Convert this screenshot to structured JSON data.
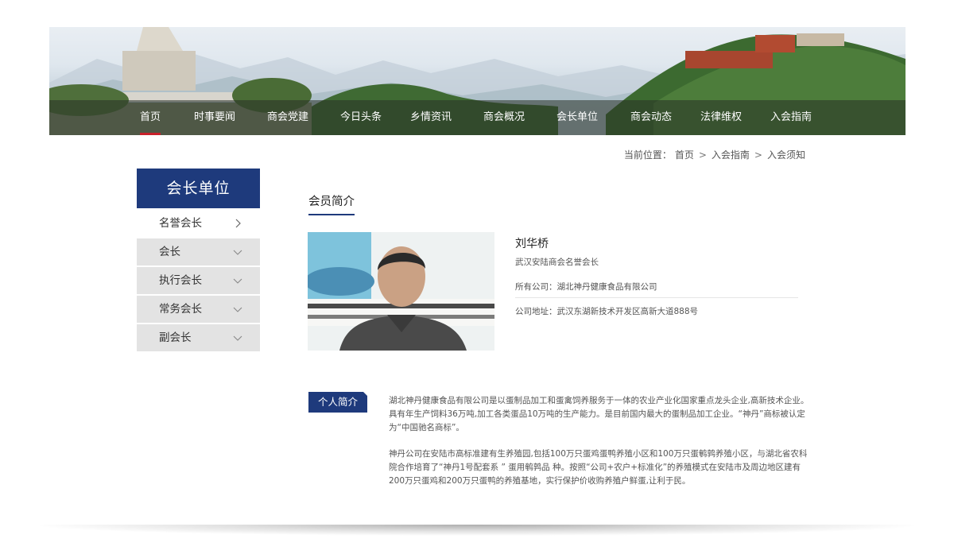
{
  "nav": {
    "items": [
      {
        "label": "首页"
      },
      {
        "label": "时事要闻"
      },
      {
        "label": "商会党建"
      },
      {
        "label": "今日头条"
      },
      {
        "label": "乡情资讯"
      },
      {
        "label": "商会概况"
      },
      {
        "label": "会长单位"
      },
      {
        "label": "商会动态"
      },
      {
        "label": "法律维权"
      },
      {
        "label": "入会指南"
      }
    ],
    "active_index": 0,
    "active_color": "#c8202a"
  },
  "breadcrumb": {
    "prefix": "当前位置：",
    "items": [
      "首页",
      "入会指南",
      "入会须知"
    ],
    "separator": ">"
  },
  "sidebar": {
    "title": "会长单位",
    "items": [
      {
        "label": "名誉会长",
        "icon": "chevron-right-icon"
      },
      {
        "label": "会长",
        "icon": "chevron-down-icon"
      },
      {
        "label": "执行会长",
        "icon": "chevron-down-icon"
      },
      {
        "label": "常务会长",
        "icon": "chevron-down-icon"
      },
      {
        "label": "副会长",
        "icon": "chevron-down-icon"
      }
    ]
  },
  "main": {
    "heading": "会员简介",
    "profile": {
      "name": "刘华桥",
      "role": "武汉安陆商会名誉会长",
      "company": "所有公司：湖北神丹健康食品有限公司",
      "address": "公司地址：武汉东湖新技术开发区高新大道888号"
    },
    "intro": {
      "tag": "个人简介",
      "p1": "湖北神丹健康食品有限公司是以蛋制品加工和蛋禽饲养服务于一体的农业产业化国家重点龙头企业,高新技术企业。具有年生产饲料36万吨,加工各类蛋品10万吨的生产能力。是目前国内最大的蛋制品加工企业。“神丹”商标被认定为“中国驰名商标”。",
      "p2": "神丹公司在安陆市高标准建有生养殖园,包括100万只蛋鸡蛋鸭养殖小区和100万只蛋鹌鹑养殖小区，与湖北省农科院合作培育了“神丹1号配套系 ” 蛋用鹌鹑品 种。按照“公司+农户+标准化”的养殖模式在安陆市及周边地区建有200万只蛋鸡和200万只蛋鸭的养殖基地，实行保护价收购养殖户鲜蛋,让利于民。"
    }
  },
  "colors": {
    "brand": "#1e3a7c",
    "sidebar_item_bg": "#e3e3e3"
  }
}
